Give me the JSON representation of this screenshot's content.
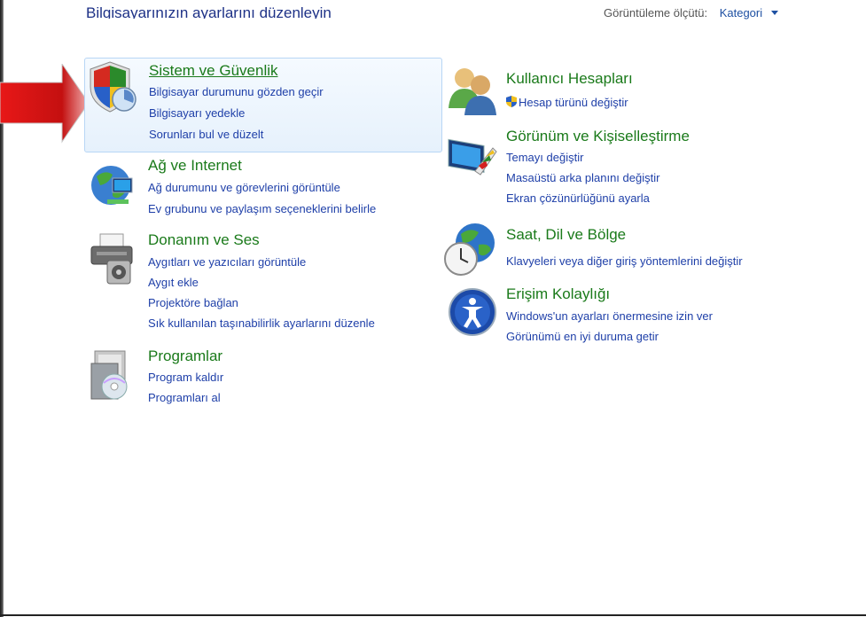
{
  "header": {
    "title": "Bilgisayarınızın ayarlarını düzenleyin",
    "view_by_label": "Görüntüleme ölçütü:",
    "view_by_value": "Kategori"
  },
  "categories": [
    {
      "title": "Sistem ve Güvenlik",
      "icon": "shield-icon",
      "links": [
        "Bilgisayar durumunu gözden geçir",
        "Bilgisayarı yedekle",
        "Sorunları bul ve düzelt"
      ]
    },
    {
      "title": "Ağ ve Internet",
      "icon": "network-globe-icon",
      "links": [
        "Ağ durumunu ve görevlerini görüntüle",
        "Ev grubunu ve paylaşım seçeneklerini belirle"
      ]
    },
    {
      "title": "Donanım ve Ses",
      "icon": "printer-icon",
      "links": [
        "Aygıtları ve yazıcıları görüntüle",
        "Aygıt ekle",
        "Projektöre bağlan",
        "Sık kullanılan taşınabilirlik ayarlarını düzenle"
      ]
    },
    {
      "title": "Programlar",
      "icon": "programs-icon",
      "links": [
        "Program kaldır",
        "Programları al"
      ]
    },
    {
      "title": "Kullanıcı Hesapları",
      "icon": "users-icon",
      "links": [
        "Hesap türünü değiştir"
      ]
    },
    {
      "title": "Görünüm ve Kişiselleştirme",
      "icon": "appearance-icon",
      "links": [
        "Temayı değiştir",
        "Masaüstü arka planını değiştir",
        "Ekran çözünürlüğünü ayarla"
      ]
    },
    {
      "title": "Saat, Dil ve Bölge",
      "icon": "clock-globe-icon",
      "links": [
        "Klavyeleri veya diğer giriş yöntemlerini değiştir"
      ]
    },
    {
      "title": "Erişim Kolaylığı",
      "icon": "accessibility-icon",
      "links": [
        "Windows'un ayarları önermesine izin ver",
        "Görünümü en iyi duruma getir"
      ]
    }
  ],
  "colors": {
    "title_green": "#1a7a1a",
    "link_blue": "#1e3fa8",
    "arrow_red": "#d42020"
  }
}
